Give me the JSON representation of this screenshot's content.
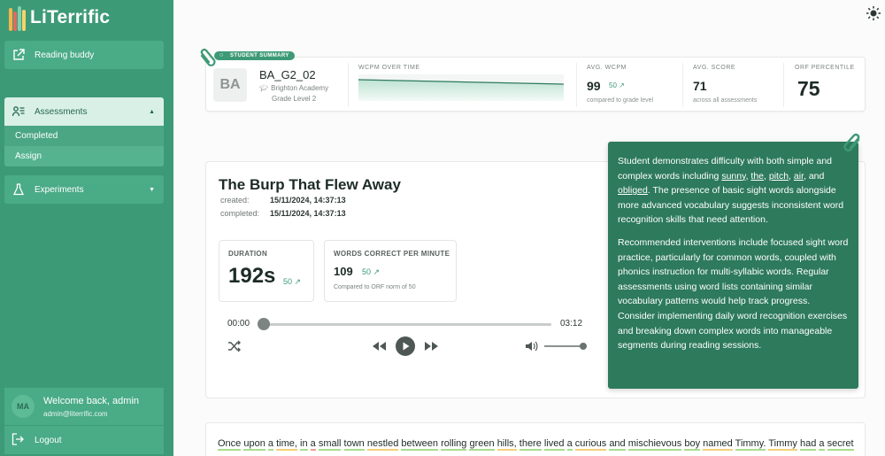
{
  "app": {
    "brand": "LiTerrific"
  },
  "sidebar": {
    "items": [
      {
        "label": "Reading buddy",
        "icon": "external-link-icon"
      },
      {
        "label": "Assessments",
        "icon": "assessment-icon"
      },
      {
        "label": "Experiments",
        "icon": "flask-icon"
      }
    ],
    "sub_items": [
      "Completed",
      "Assign"
    ],
    "user": {
      "initials": "MA",
      "welcome": "Welcome back, admin",
      "email": "admin@literrific.com"
    },
    "logout": "Logout"
  },
  "summary": {
    "tag": "STUDENT SUMMARY",
    "initials": "BA",
    "student_id": "BA_G2_02",
    "school": "Brighton Academy",
    "grade": "Grade Level 2",
    "wcpm_label": "WCPM OVER TIME",
    "avg_wcpm_label": "AVG. WCPM",
    "avg_wcpm": "99",
    "avg_wcpm_badge": "50 ↗",
    "avg_wcpm_sub": "compared to grade level",
    "avg_score_label": "AVG. SCORE",
    "avg_score": "71",
    "avg_score_sub": "across all assessments",
    "orf_label": "ORF PERCENTILE",
    "orf": "75"
  },
  "assessment": {
    "title": "The Burp That Flew Away",
    "created_label": "created:",
    "created": "15/11/2024, 14:37:13",
    "completed_label": "completed:",
    "completed": "15/11/2024, 14:37:13",
    "duration_label": "DURATION",
    "duration": "192s",
    "duration_badge": "50 ↗",
    "wcpm_label": "WORDS CORRECT PER MINUTE",
    "wcpm": "109",
    "wcpm_badge": "50 ↗",
    "wcpm_note": "Compared to ORF norm of 50",
    "time_current": "00:00",
    "time_total": "03:12",
    "progress": 0
  },
  "insight": {
    "p1_a": "Student demonstrates difficulty with both simple and complex words including ",
    "w1": "sunny",
    "w2": "the",
    "w3": "pitch",
    "w4": "air",
    "w5": "obliged",
    "p1_b": ". The presence of basic sight words alongside more advanced vocabulary suggests inconsistent word recognition skills that need attention.",
    "p2": "Recommended interventions include focused sight word practice, particularly for common words, coupled with phonics instruction for multi-syllabic words. Regular assessments using word lists containing similar vocabulary patterns would help track progress. Consider implementing daily word recognition exercises and breaking down complex words into manageable segments during reading sessions."
  },
  "story": {
    "words": [
      "Once",
      "upon",
      "a",
      "time,",
      "in",
      "a",
      "small",
      "town",
      "nestled",
      "between",
      "rolling",
      "green",
      "hills,",
      "there",
      "lived",
      "a",
      "curious",
      "and",
      "mischievous",
      "boy",
      "named",
      "Timmy.",
      "Timmy",
      "had",
      "a",
      "secret"
    ]
  },
  "colors": {
    "accent": "#3d9a77",
    "sidebar": "#3d9a77",
    "insight_bg": "#2d7a5c"
  }
}
